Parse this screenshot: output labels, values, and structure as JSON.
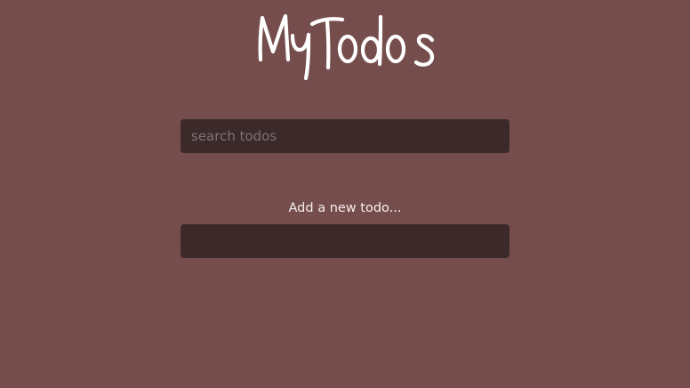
{
  "app": {
    "title": "MyTodos"
  },
  "search": {
    "placeholder": "search todos",
    "value": ""
  },
  "add": {
    "label": "Add a new todo...",
    "value": ""
  },
  "colors": {
    "background": "#754d4c",
    "input_background": "#3c2a2a",
    "text": "#ffffff",
    "placeholder": "#7e7272"
  }
}
